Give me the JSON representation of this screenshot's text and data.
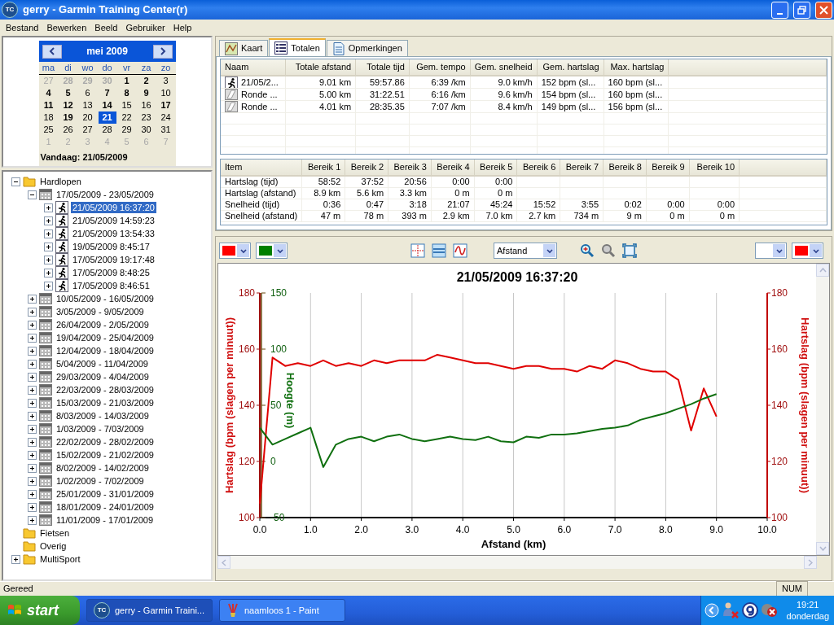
{
  "window": {
    "icon_text": "TC",
    "title": "gerry - Garmin Training Center(r)"
  },
  "menu": [
    "Bestand",
    "Bewerken",
    "Beeld",
    "Gebruiker",
    "Help"
  ],
  "calendar": {
    "month": "mei 2009",
    "weekdays": [
      "ma",
      "di",
      "wo",
      "do",
      "vr",
      "za",
      "zo"
    ],
    "days": [
      {
        "label": "27",
        "other_month": true,
        "has_activity": false,
        "selected": false
      },
      {
        "label": "28",
        "other_month": true,
        "has_activity": true,
        "selected": false
      },
      {
        "label": "29",
        "other_month": true,
        "has_activity": true,
        "selected": false
      },
      {
        "label": "30",
        "other_month": true,
        "has_activity": true,
        "selected": false
      },
      {
        "label": "1",
        "other_month": false,
        "has_activity": true,
        "selected": false
      },
      {
        "label": "2",
        "other_month": false,
        "has_activity": true,
        "selected": false
      },
      {
        "label": "3",
        "other_month": false,
        "has_activity": false,
        "selected": false
      },
      {
        "label": "4",
        "other_month": false,
        "has_activity": true,
        "selected": false
      },
      {
        "label": "5",
        "other_month": false,
        "has_activity": true,
        "selected": false
      },
      {
        "label": "6",
        "other_month": false,
        "has_activity": false,
        "selected": false
      },
      {
        "label": "7",
        "other_month": false,
        "has_activity": true,
        "selected": false
      },
      {
        "label": "8",
        "other_month": false,
        "has_activity": true,
        "selected": false
      },
      {
        "label": "9",
        "other_month": false,
        "has_activity": true,
        "selected": false
      },
      {
        "label": "10",
        "other_month": false,
        "has_activity": false,
        "selected": false
      },
      {
        "label": "11",
        "other_month": false,
        "has_activity": true,
        "selected": false
      },
      {
        "label": "12",
        "other_month": false,
        "has_activity": true,
        "selected": false
      },
      {
        "label": "13",
        "other_month": false,
        "has_activity": false,
        "selected": false
      },
      {
        "label": "14",
        "other_month": false,
        "has_activity": true,
        "selected": false
      },
      {
        "label": "15",
        "other_month": false,
        "has_activity": false,
        "selected": false
      },
      {
        "label": "16",
        "other_month": false,
        "has_activity": false,
        "selected": false
      },
      {
        "label": "17",
        "other_month": false,
        "has_activity": true,
        "selected": false
      },
      {
        "label": "18",
        "other_month": false,
        "has_activity": false,
        "selected": false
      },
      {
        "label": "19",
        "other_month": false,
        "has_activity": true,
        "selected": false
      },
      {
        "label": "20",
        "other_month": false,
        "has_activity": false,
        "selected": false
      },
      {
        "label": "21",
        "other_month": false,
        "has_activity": true,
        "selected": true
      },
      {
        "label": "22",
        "other_month": false,
        "has_activity": false,
        "selected": false
      },
      {
        "label": "23",
        "other_month": false,
        "has_activity": false,
        "selected": false
      },
      {
        "label": "24",
        "other_month": false,
        "has_activity": false,
        "selected": false
      },
      {
        "label": "25",
        "other_month": false,
        "has_activity": false,
        "selected": false
      },
      {
        "label": "26",
        "other_month": false,
        "has_activity": false,
        "selected": false
      },
      {
        "label": "27",
        "other_month": false,
        "has_activity": false,
        "selected": false
      },
      {
        "label": "28",
        "other_month": false,
        "has_activity": false,
        "selected": false
      },
      {
        "label": "29",
        "other_month": false,
        "has_activity": false,
        "selected": false
      },
      {
        "label": "30",
        "other_month": false,
        "has_activity": false,
        "selected": false
      },
      {
        "label": "31",
        "other_month": false,
        "has_activity": false,
        "selected": false
      },
      {
        "label": "1",
        "other_month": true,
        "has_activity": false,
        "selected": false
      },
      {
        "label": "2",
        "other_month": true,
        "has_activity": false,
        "selected": false
      },
      {
        "label": "3",
        "other_month": true,
        "has_activity": false,
        "selected": false
      },
      {
        "label": "4",
        "other_month": true,
        "has_activity": false,
        "selected": false
      },
      {
        "label": "5",
        "other_month": true,
        "has_activity": false,
        "selected": false
      },
      {
        "label": "6",
        "other_month": true,
        "has_activity": false,
        "selected": false
      },
      {
        "label": "7",
        "other_month": true,
        "has_activity": false,
        "selected": false
      }
    ],
    "today": "Vandaag: 21/05/2009"
  },
  "tree": [
    {
      "label": "Hardlopen",
      "kind": "folder",
      "expanded": true,
      "selected": false,
      "children": [
        {
          "label": "17/05/2009 - 23/05/2009",
          "kind": "week",
          "expanded": true,
          "selected": false,
          "children": [
            {
              "label": "21/05/2009 16:37:20",
              "kind": "run",
              "expanded": false,
              "selected": true
            },
            {
              "label": "21/05/2009 14:59:23",
              "kind": "run",
              "expanded": false,
              "selected": false
            },
            {
              "label": "21/05/2009 13:54:33",
              "kind": "run",
              "expanded": false,
              "selected": false
            },
            {
              "label": "19/05/2009 8:45:17",
              "kind": "run",
              "expanded": false,
              "selected": false
            },
            {
              "label": "17/05/2009 19:17:48",
              "kind": "run",
              "expanded": false,
              "selected": false
            },
            {
              "label": "17/05/2009 8:48:25",
              "kind": "run",
              "expanded": false,
              "selected": false
            },
            {
              "label": "17/05/2009 8:46:51",
              "kind": "run",
              "expanded": false,
              "selected": false
            }
          ]
        },
        {
          "label": "10/05/2009 - 16/05/2009",
          "kind": "week",
          "expanded": false,
          "selected": false
        },
        {
          "label": "3/05/2009 - 9/05/2009",
          "kind": "week",
          "expanded": false,
          "selected": false
        },
        {
          "label": "26/04/2009 - 2/05/2009",
          "kind": "week",
          "expanded": false,
          "selected": false
        },
        {
          "label": "19/04/2009 - 25/04/2009",
          "kind": "week",
          "expanded": false,
          "selected": false
        },
        {
          "label": "12/04/2009 - 18/04/2009",
          "kind": "week",
          "expanded": false,
          "selected": false
        },
        {
          "label": "5/04/2009 - 11/04/2009",
          "kind": "week",
          "expanded": false,
          "selected": false
        },
        {
          "label": "29/03/2009 - 4/04/2009",
          "kind": "week",
          "expanded": false,
          "selected": false
        },
        {
          "label": "22/03/2009 - 28/03/2009",
          "kind": "week",
          "expanded": false,
          "selected": false
        },
        {
          "label": "15/03/2009 - 21/03/2009",
          "kind": "week",
          "expanded": false,
          "selected": false
        },
        {
          "label": "8/03/2009 - 14/03/2009",
          "kind": "week",
          "expanded": false,
          "selected": false
        },
        {
          "label": "1/03/2009 - 7/03/2009",
          "kind": "week",
          "expanded": false,
          "selected": false
        },
        {
          "label": "22/02/2009 - 28/02/2009",
          "kind": "week",
          "expanded": false,
          "selected": false
        },
        {
          "label": "15/02/2009 - 21/02/2009",
          "kind": "week",
          "expanded": false,
          "selected": false
        },
        {
          "label": "8/02/2009 - 14/02/2009",
          "kind": "week",
          "expanded": false,
          "selected": false
        },
        {
          "label": "1/02/2009 - 7/02/2009",
          "kind": "week",
          "expanded": false,
          "selected": false
        },
        {
          "label": "25/01/2009 - 31/01/2009",
          "kind": "week",
          "expanded": false,
          "selected": false
        },
        {
          "label": "18/01/2009 - 24/01/2009",
          "kind": "week",
          "expanded": false,
          "selected": false
        },
        {
          "label": "11/01/2009 - 17/01/2009",
          "kind": "week",
          "expanded": false,
          "selected": false
        }
      ]
    },
    {
      "label": "Fietsen",
      "kind": "folder",
      "selected": false
    },
    {
      "label": "Overig",
      "kind": "folder",
      "selected": false
    },
    {
      "label": "MultiSport",
      "kind": "folder",
      "expanded": false,
      "selected": false
    }
  ],
  "tabs": [
    {
      "label": "Kaart",
      "kind": "map",
      "selected": false
    },
    {
      "label": "Totalen",
      "kind": "list",
      "selected": true
    },
    {
      "label": "Opmerkingen",
      "kind": "notes",
      "selected": false
    }
  ],
  "totals": {
    "columns": [
      "Naam",
      "Totale afstand",
      "Totale tijd",
      "Gem. tempo",
      "Gem. snelheid",
      "Gem. hartslag",
      "Max. hartslag"
    ],
    "rows": [
      {
        "kind": "run",
        "cells": [
          "21/05/2...",
          "9.01 km",
          "59:57.86",
          "6:39 /km",
          "9.0 km/h",
          "152 bpm (sl...",
          "160 bpm (sl..."
        ]
      },
      {
        "kind": "lap",
        "cells": [
          "Ronde ...",
          "5.00 km",
          "31:22.51",
          "6:16 /km",
          "9.6 km/h",
          "154 bpm (sl...",
          "160 bpm (sl..."
        ]
      },
      {
        "kind": "lap",
        "cells": [
          "Ronde ...",
          "4.01 km",
          "28:35.35",
          "7:07 /km",
          "8.4 km/h",
          "149 bpm (sl...",
          "156 bpm (sl..."
        ]
      }
    ]
  },
  "zones": {
    "columns": [
      "Item",
      "Bereik 1",
      "Bereik 2",
      "Bereik 3",
      "Bereik 4",
      "Bereik 5",
      "Bereik 6",
      "Bereik 7",
      "Bereik 8",
      "Bereik 9",
      "Bereik 10"
    ],
    "rows": [
      [
        "Hartslag (tijd)",
        "58:52",
        "37:52",
        "20:56",
        "0:00",
        "0:00"
      ],
      [
        "Hartslag (afstand)",
        "8.9 km",
        "5.6 km",
        "3.3 km",
        "0 m",
        "0 m"
      ],
      [
        "Snelheid (tijd)",
        "0:36",
        "0:47",
        "3:18",
        "21:07",
        "45:24",
        "15:52",
        "3:55",
        "0:02",
        "0:00",
        "0:00"
      ],
      [
        "Snelheid (afstand)",
        "47 m",
        "78 m",
        "393 m",
        "2.9 km",
        "7.0 km",
        "2.7 km",
        "734 m",
        "9 m",
        "0 m",
        "0 m"
      ]
    ]
  },
  "chart_toolbar": {
    "left_pickers": [
      {
        "kind": "swatch",
        "color": "#ff0000"
      },
      {
        "kind": "swatch",
        "color": "#008000"
      }
    ],
    "x_axis": "Afstand",
    "right_pickers": [
      {
        "kind": "empty"
      },
      {
        "kind": "swatch",
        "color": "#ff0000"
      }
    ]
  },
  "chart": {
    "chart_data": {
      "type": "line",
      "title": "21/05/2009 16:37:20",
      "xlabel": "Afstand (km)",
      "ylabel": "Hartslag (bpm (slagen per minuut))",
      "y2label": "Hoogte (m)",
      "grid": true,
      "annotations": [
        "Hartslag (bpm (slagen per minuut))",
        "180",
        "160",
        "140",
        "120",
        "100"
      ],
      "xlim": [
        0,
        10
      ],
      "ylim": [
        100,
        180
      ],
      "y2lim": [
        -50,
        150
      ],
      "xticks": [
        {
          "value": 0,
          "label": "0.0"
        },
        {
          "value": 1,
          "label": "1.0"
        },
        {
          "value": 2,
          "label": "2.0"
        },
        {
          "value": 3,
          "label": "3.0"
        },
        {
          "value": 4,
          "label": "4.0"
        },
        {
          "value": 5,
          "label": "5.0"
        },
        {
          "value": 6,
          "label": "6.0"
        },
        {
          "value": 7,
          "label": "7.0"
        },
        {
          "value": 8,
          "label": "8.0"
        },
        {
          "value": 9,
          "label": "9.0"
        },
        {
          "value": 10,
          "label": "10.0"
        }
      ],
      "yticks": [
        100,
        120,
        140,
        160,
        180
      ],
      "y2ticks": [
        -50,
        0,
        50,
        100,
        150
      ],
      "x": [
        0,
        0.25,
        0.5,
        0.75,
        1,
        1.25,
        1.5,
        1.75,
        2,
        2.25,
        2.5,
        2.75,
        3,
        3.25,
        3.5,
        3.75,
        4,
        4.25,
        4.5,
        4.75,
        5,
        5.25,
        5.5,
        5.75,
        6,
        6.25,
        6.5,
        6.75,
        7,
        7.25,
        7.5,
        7.75,
        8,
        8.25,
        8.5,
        8.75,
        9
      ],
      "series": [
        {
          "axis": "y",
          "color": "#e00000",
          "values": [
            105,
            157,
            154,
            155,
            154,
            156,
            154,
            155,
            154,
            156,
            155,
            156,
            156,
            156,
            158,
            157,
            156,
            155,
            155,
            154,
            153,
            154,
            154,
            153,
            153,
            152,
            154,
            153,
            156,
            155,
            153,
            152,
            152,
            149,
            131,
            146,
            136
          ]
        },
        {
          "axis": "y2",
          "color": "#107010",
          "values": [
            30,
            15,
            20,
            25,
            30,
            -5,
            15,
            20,
            22,
            18,
            22,
            24,
            20,
            18,
            20,
            22,
            20,
            19,
            22,
            18,
            17,
            22,
            21,
            24,
            24,
            25,
            27,
            29,
            30,
            32,
            37,
            40,
            43,
            47,
            51,
            56,
            60
          ]
        }
      ]
    }
  },
  "status_bar": {
    "text": "Gereed",
    "num": "NUM"
  },
  "taskbar": {
    "start": "start",
    "tasks": [
      {
        "icon_text": "TC",
        "label": "gerry - Garmin Traini...",
        "kind": "tc",
        "selected": true
      },
      {
        "label": "naamloos 1 - Paint",
        "kind": "paint",
        "selected": false
      }
    ],
    "clock": "19:21",
    "day": "donderdag"
  }
}
